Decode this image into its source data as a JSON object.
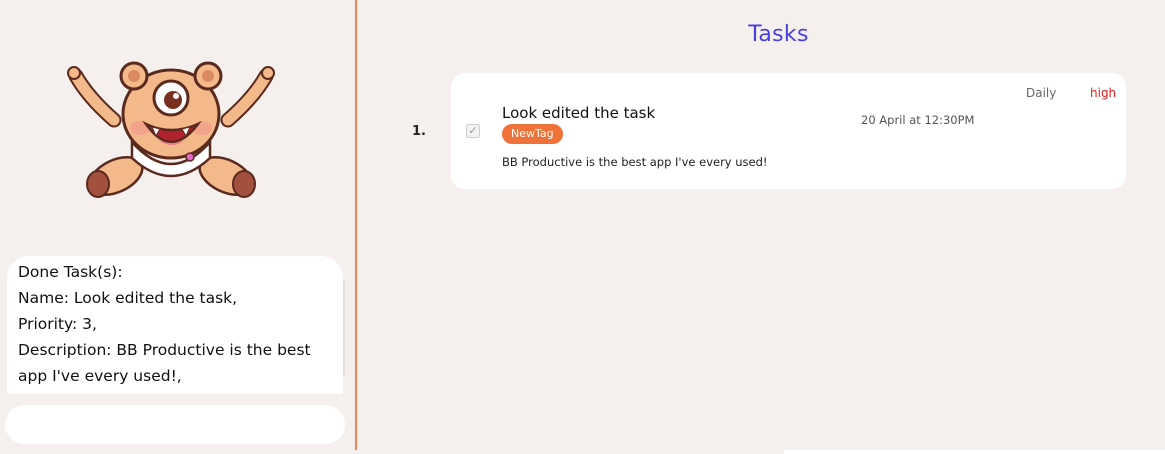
{
  "result_display": {
    "lines": [
      "Done Task(s):",
      "Name: Look edited the task,",
      "Priority: 3,",
      "Description: BB Productive is the best",
      "app I've every used!,"
    ]
  },
  "command_box": {
    "value": "",
    "placeholder": ""
  },
  "task_list": {
    "title": "Tasks",
    "tasks": [
      {
        "index": "1.",
        "name": "Look edited the task",
        "tag": "NewTag",
        "description": "BB Productive is the best app I've every used!",
        "date": "20 April at 12:30PM",
        "recurrence": "Daily",
        "priority": "high",
        "done": true
      }
    ]
  },
  "colors": {
    "title": "#4a3fe0",
    "tag_bg": "#f07238",
    "priority_high": "#e21b1b",
    "divider": "#e9875b",
    "background": "#f5f0ee"
  },
  "icons": {
    "mascot": "one-eyed-bear-mascot",
    "checkbox": "check-icon"
  }
}
